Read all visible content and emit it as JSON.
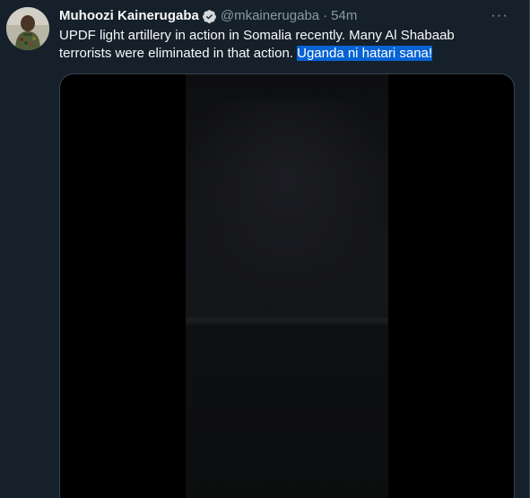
{
  "tweet": {
    "display_name": "Muhoozi Kainerugaba",
    "handle": "@mkainerugaba",
    "separator": "·",
    "time": "54m",
    "more_label": "···",
    "text_main": "UPDF light artillery in action in Somalia recently. Many Al Shabaab terrorists were eliminated in that action. ",
    "text_highlighted": "Uganda ni hatari sana!",
    "verified": true
  },
  "colors": {
    "background": "#15202b",
    "text": "#f7f9f9",
    "secondary_text": "#8b98a5",
    "verified_badge": "#d6d9db",
    "selection_highlight": "#0563d3"
  },
  "icons": {
    "verified": "verified-badge-icon",
    "more": "more-options-icon"
  }
}
